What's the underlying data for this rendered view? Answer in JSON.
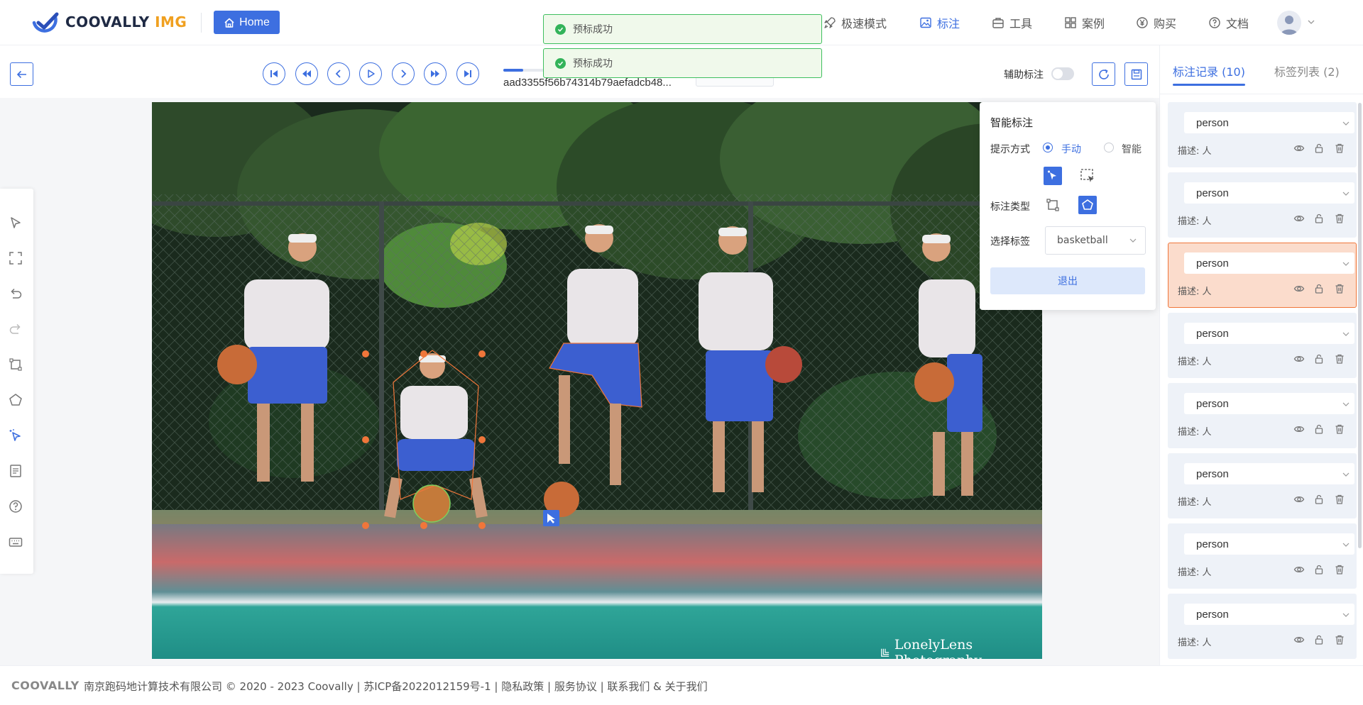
{
  "brand": {
    "name": "COOVALLY",
    "suffix": "IMG"
  },
  "header": {
    "home_label": "Home",
    "nav": [
      {
        "label": "极速模式",
        "icon": "rocket-icon"
      },
      {
        "label": "标注",
        "icon": "image-icon",
        "active": true
      },
      {
        "label": "工具",
        "icon": "toolbox-icon"
      },
      {
        "label": "案例",
        "icon": "grid-icon"
      },
      {
        "label": "购买",
        "icon": "yen-icon"
      },
      {
        "label": "文档",
        "icon": "help-icon"
      }
    ]
  },
  "toasts": [
    {
      "text": "预标成功"
    },
    {
      "text": "预标成功"
    }
  ],
  "toolbar": {
    "filename": "aad3355f56b74314b79aefadcb48...",
    "progress_fraction": 0.11,
    "assist_label": "辅助标注",
    "assist_on": false
  },
  "smart_panel": {
    "title": "智能标注",
    "prompt_label": "提示方式",
    "prompt_options": [
      "手动",
      "智能"
    ],
    "type_label": "标注类型",
    "tag_label": "选择标签",
    "tag_value": "basketball",
    "exit_label": "退出"
  },
  "right_panel": {
    "tabs": [
      "标注记录 (10)",
      "标签列表 (2)"
    ],
    "records": [
      {
        "label": "person",
        "desc": "描述: 人"
      },
      {
        "label": "person",
        "desc": "描述: 人"
      },
      {
        "label": "person",
        "desc": "描述: 人",
        "highlighted": true
      },
      {
        "label": "person",
        "desc": "描述: 人"
      },
      {
        "label": "person",
        "desc": "描述: 人"
      },
      {
        "label": "person",
        "desc": "描述: 人"
      },
      {
        "label": "person",
        "desc": "描述: 人"
      },
      {
        "label": "person",
        "desc": "描述: 人"
      }
    ]
  },
  "watermark": "LonelyLens Photography",
  "footer": {
    "logo": "COOVALLY",
    "text": "南京跑码地计算技术有限公司 © 2020 - 2023 Coovally | 苏ICP备2022012159号-1 | 隐私政策 | 服务协议 | 联系我们 & 关于我们"
  },
  "colors": {
    "accent": "#3d6fe0",
    "highlight_bg": "#fbdccc",
    "highlight_border": "#f0763a",
    "success": "#33b35a"
  }
}
